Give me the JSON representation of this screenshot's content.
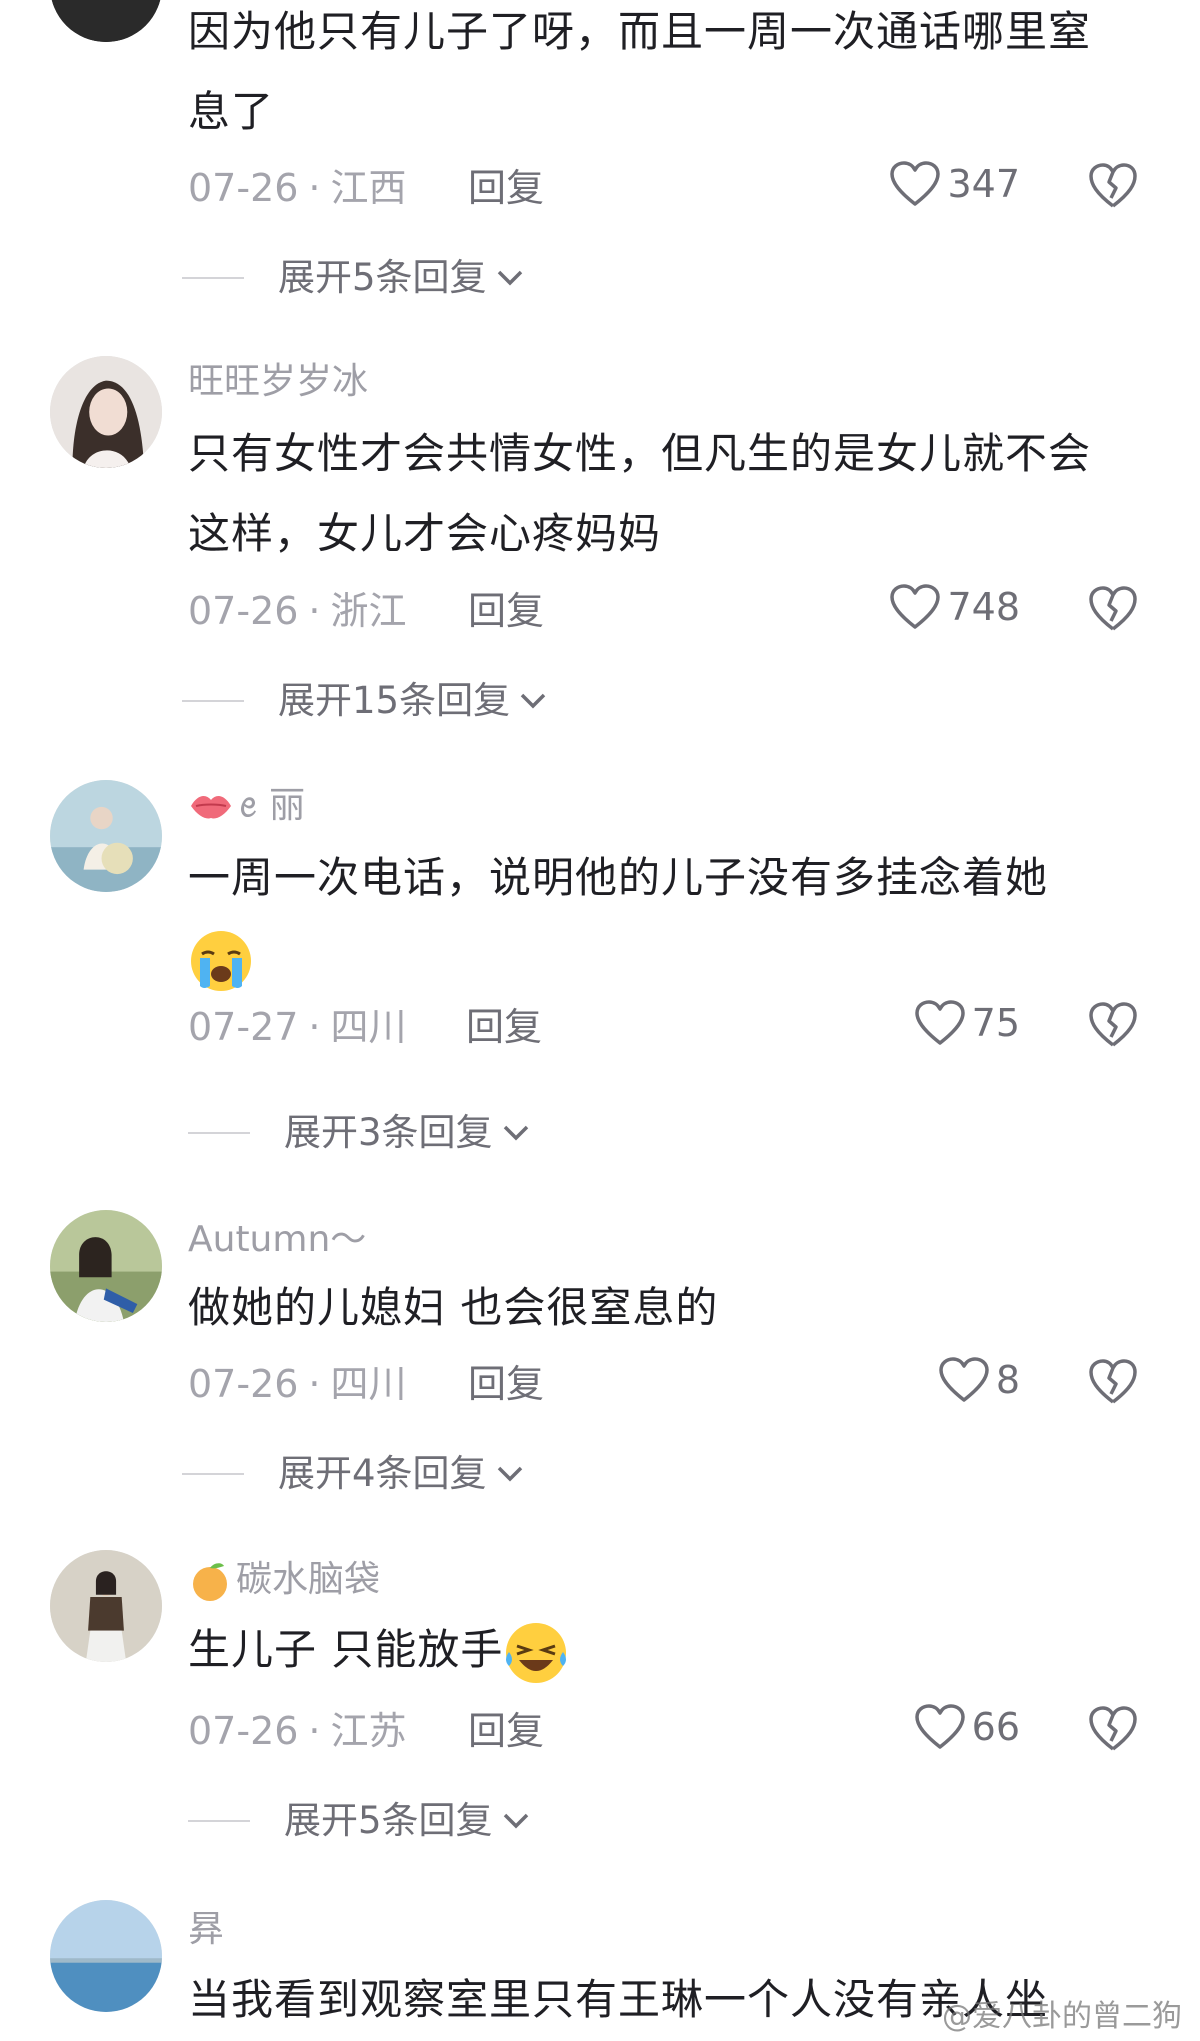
{
  "comments": [
    {
      "username": "",
      "text": "因为他只有儿子了呀，而且一周一次通话哪里窒息了",
      "date": "07-26",
      "location": "江西",
      "reply_label": "回复",
      "likes": "347",
      "expand_label": "展开5条回复"
    },
    {
      "username": "旺旺岁岁冰",
      "text": "只有女性才会共情女性，但凡生的是女儿就不会这样，女儿才会心疼妈妈",
      "date": "07-26",
      "location": "浙江",
      "reply_label": "回复",
      "likes": "748",
      "expand_label": "展开15条回复"
    },
    {
      "username": "ꫀ  丽",
      "badge_icon": "kiss-mark-icon",
      "text": "一周一次电话，说明他的儿子没有多挂念着她",
      "emoji": "loudly-crying-face-emoji",
      "date": "07-27",
      "location": "四川",
      "reply_label": "回复",
      "likes": "75",
      "expand_label": "展开3条回复"
    },
    {
      "username": "Autumn～",
      "text": "做她的儿媳妇 也会很窒息的",
      "date": "07-26",
      "location": "四川",
      "reply_label": "回复",
      "likes": "8",
      "expand_label": "展开4条回复"
    },
    {
      "username": "碳水脑袋",
      "badge_icon": "tangerine-icon",
      "text": "生儿子 只能放手",
      "emoji": "laughing-tears-face-emoji",
      "date": "07-26",
      "location": "江苏",
      "reply_label": "回复",
      "likes": "66",
      "expand_label": "展开5条回复"
    },
    {
      "username": "昪",
      "text": "当我看到观察室里只有王琳一个人没有亲人坐"
    }
  ],
  "watermark": "@爱八卦的曾二狗",
  "colors": {
    "text": "#1f1f24",
    "meta": "#a4a4ac",
    "action": "#6e6e76",
    "background": "#ffffff"
  }
}
